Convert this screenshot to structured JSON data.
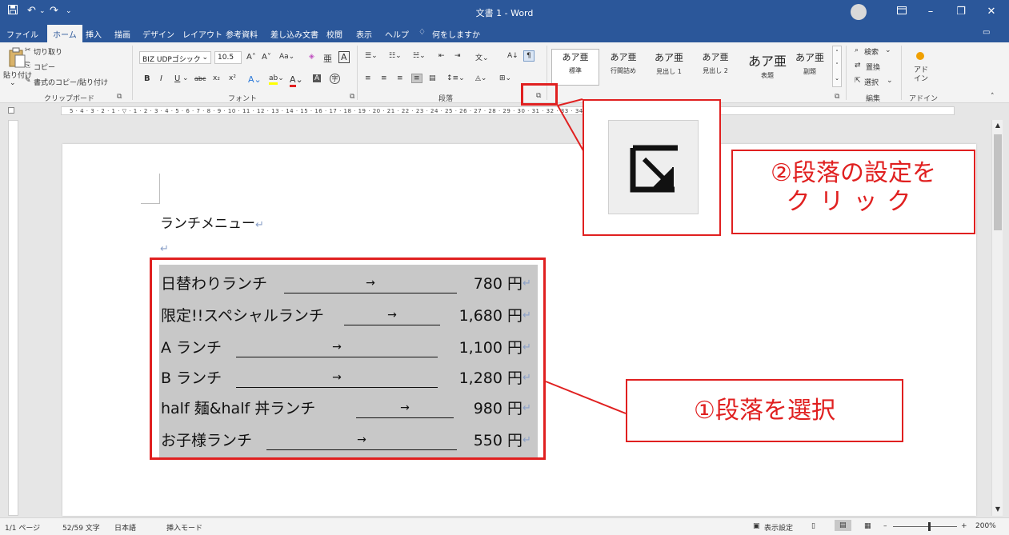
{
  "titlebar": {
    "title": "文書 1 - Word",
    "save_icon": "save-icon",
    "undo": "↶",
    "redo": "↷",
    "qa_more": "⌄",
    "minimize": "–",
    "restore": "❐",
    "close": "✕"
  },
  "tabs": [
    "ファイル",
    "ホーム",
    "挿入",
    "描画",
    "デザイン",
    "レイアウト",
    "参考資料",
    "差し込み文書",
    "校閲",
    "表示",
    "ヘルプ"
  ],
  "tell_me": "何をしますか",
  "ribbon": {
    "clipboard": {
      "paste": "貼り付け",
      "cut": "切り取り",
      "copy": "コピー",
      "format_painter": "書式のコピー/貼り付け",
      "label": "クリップボード"
    },
    "font": {
      "font_name": "BIZ UDPゴシック",
      "font_size": "10.5",
      "label": "フォント"
    },
    "paragraph": {
      "label": "段落"
    },
    "styles": {
      "items": [
        {
          "sample": "あア亜",
          "name": "標準"
        },
        {
          "sample": "あア亜",
          "name": "行間詰め"
        },
        {
          "sample": "あア亜",
          "name": "見出し 1"
        },
        {
          "sample": "あア亜",
          "name": "見出し 2"
        },
        {
          "sample": "あア亜",
          "name": "表題"
        },
        {
          "sample": "あア亜",
          "name": "副題"
        }
      ],
      "label": "スタイル"
    },
    "editing": {
      "find": "検索",
      "replace": "置換",
      "select": "選択",
      "label": "編集"
    },
    "addins": {
      "button": "アド イン",
      "label": "アドイン"
    }
  },
  "ruler_ticks": "5 · 4 · 3 · 2 · 1 · ▽ · 1 · 2 · 3 · 4 · 5 · 6 · 7 · 8 · 9 · 10 · 11 · 12 · 13 · 14 · 15 · 16 · 17 · 18 · 19 · 20 · 21 · 22 · 23 · 24 · 25 · 26 · 27 · 28 · 29 · 30 · 31 · 32 · 33 · 34 · 35 · 36 · 37 · 38 · 39 · 40 · 41 · 42 · 43",
  "document": {
    "title": "ランチメニュー",
    "para_mark": "↵",
    "menu": [
      {
        "name": "日替わりランチ",
        "arrow": "→",
        "price": "780 円"
      },
      {
        "name": "限定!!スペシャルランチ",
        "arrow": "→",
        "price": "1,680 円"
      },
      {
        "name": "A ランチ",
        "arrow": "→",
        "price": "1,100 円"
      },
      {
        "name": "B ランチ",
        "arrow": "→",
        "price": "1,280 円"
      },
      {
        "name": "half 麺&half 丼ランチ",
        "arrow": "→",
        "price": "980 円"
      },
      {
        "name": "お子様ランチ",
        "arrow": "→",
        "price": "550 円"
      }
    ]
  },
  "annotations": {
    "step1": "①段落を選択",
    "step2_line1": "②段落の設定を",
    "step2_line2": "クリック"
  },
  "status": {
    "page": "1/1 ページ",
    "words": "52/59 文字",
    "language": "日本語",
    "mode": "挿入モード",
    "display_settings": "表示設定",
    "zoom": "200%"
  },
  "colors": {
    "word_blue": "#2b579a",
    "annotation_red": "#e02020",
    "selection_gray": "#c8c8c8"
  }
}
